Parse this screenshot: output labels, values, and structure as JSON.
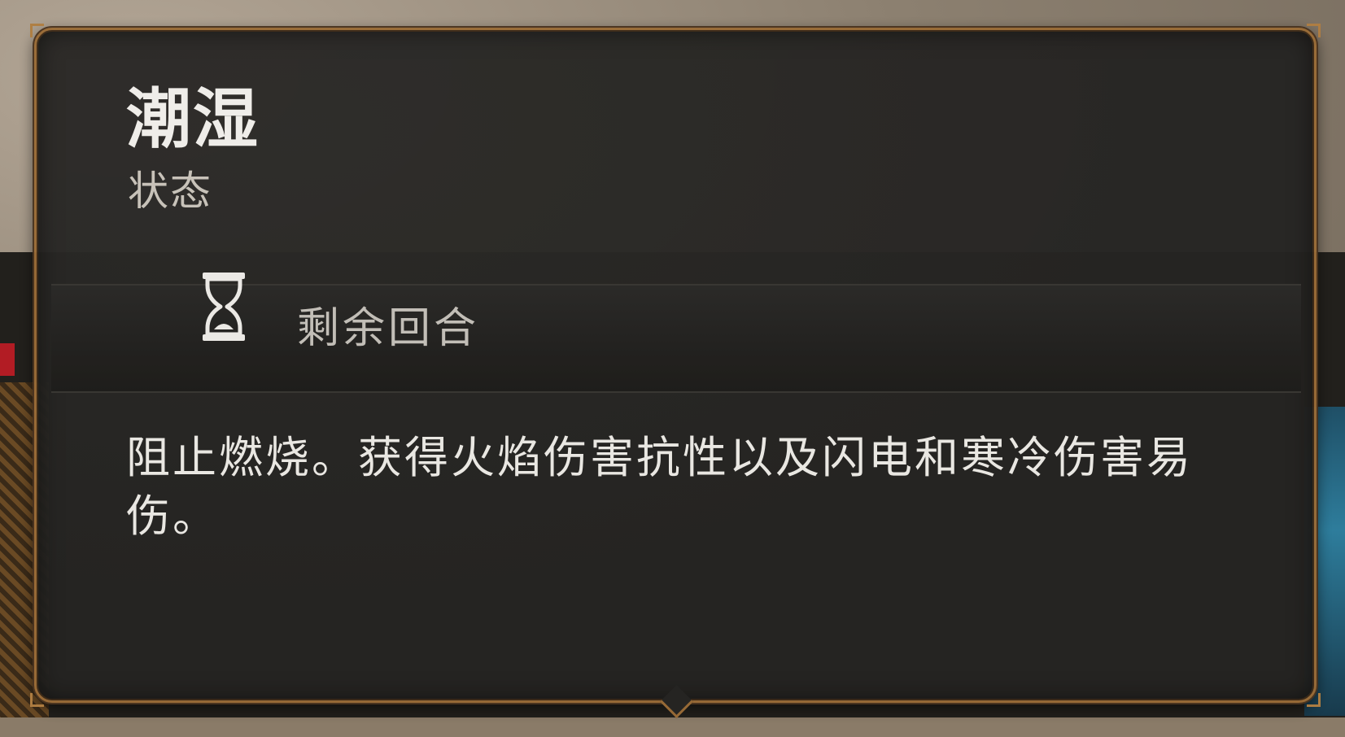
{
  "tooltip": {
    "title": "潮湿",
    "type_label": "状态",
    "duration_label": "剩余回合",
    "description": "阻止燃烧。获得火焰伤害抗性以及闪电和寒冷伤害易伤。"
  },
  "icons": {
    "duration": "hourglass-icon"
  },
  "colors": {
    "panel_bg": "#262523",
    "border": "#9a6c37",
    "title_text": "#f2f0ec",
    "subtitle_text": "#c9c4bb"
  }
}
